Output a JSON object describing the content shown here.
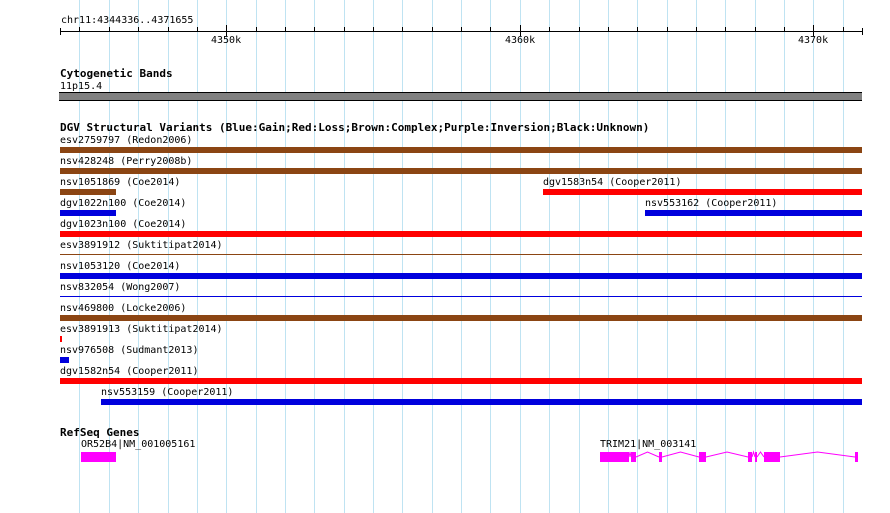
{
  "locus": "chr11:4344336..4371655",
  "ruler": {
    "ticks": [
      {
        "pos": 4350000,
        "label": "4350k"
      },
      {
        "pos": 4360000,
        "label": "4360k"
      },
      {
        "pos": 4370000,
        "label": "4370k"
      }
    ]
  },
  "tracks": {
    "cytobands": {
      "title": "Cytogenetic Bands",
      "band": "11p15.4",
      "color": "#808080"
    },
    "dgv": {
      "title": "DGV Structural Variants (Blue:Gain;Red:Loss;Brown:Complex;Purple:Inversion;Black:Unknown)",
      "colors": {
        "gain": "#0000dd",
        "loss": "#ff0000",
        "complex": "#8b4513"
      },
      "features": [
        {
          "name": "esv2759797 (Redon2006)",
          "type": "complex",
          "start": 4344336,
          "end": 4371655,
          "thick": true
        },
        {
          "name": "nsv428248 (Perry2008b)",
          "type": "complex",
          "start": 4344336,
          "end": 4371655,
          "thick": true
        },
        {
          "name": "nsv1051869 (Coe2014)",
          "type": "complex",
          "start": 4344336,
          "end": 4346250,
          "thick": true
        },
        {
          "name": "dgv1583n54 (Cooper2011)",
          "type": "loss",
          "start": 4360780,
          "end": 4371655,
          "thick": true
        },
        {
          "name": "dgv1022n100 (Coe2014)",
          "type": "gain",
          "start": 4344336,
          "end": 4346250,
          "thick": true
        },
        {
          "name": "nsv553162 (Cooper2011)",
          "type": "gain",
          "start": 4364250,
          "end": 4371655,
          "thick": true
        },
        {
          "name": "dgv1023n100 (Coe2014)",
          "type": "loss",
          "start": 4344336,
          "end": 4371655,
          "thick": true
        },
        {
          "name": "esv3891912 (Suktitipat2014)",
          "type": "complex",
          "start": 4344336,
          "end": 4371655,
          "thick": false
        },
        {
          "name": "nsv1053120 (Coe2014)",
          "type": "gain",
          "start": 4344336,
          "end": 4371655,
          "thick": true
        },
        {
          "name": "nsv832054 (Wong2007)",
          "type": "gain",
          "start": 4344336,
          "end": 4371655,
          "thick": false
        },
        {
          "name": "nsv469800 (Locke2006)",
          "type": "complex",
          "start": 4344336,
          "end": 4371655,
          "thick": true
        },
        {
          "name": "esv3891913 (Suktitipat2014)",
          "type": "loss",
          "start": 4344336,
          "end": 4344420,
          "thick": true
        },
        {
          "name": "nsv976508 (Sudmant2013)",
          "type": "gain",
          "start": 4344336,
          "end": 4344640,
          "thick": true
        },
        {
          "name": "dgv1582n54 (Cooper2011)",
          "type": "loss",
          "start": 4344336,
          "end": 4371655,
          "thick": true
        },
        {
          "name": "nsv553159 (Cooper2011)",
          "type": "gain",
          "start": 4345730,
          "end": 4371655,
          "thick": true
        }
      ]
    },
    "refseq": {
      "title": "RefSeq Genes",
      "color": "#ff00ff",
      "genes": [
        {
          "name": "OR52B4|NM_001005161",
          "start": 4345050,
          "end": 4346250,
          "exons": [
            [
              4345050,
              4346250
            ]
          ]
        },
        {
          "name": "TRIM21|NM_003141",
          "start": 4362740,
          "end": 4371520,
          "exons": [
            [
              4362740,
              4363720
            ],
            [
              4363800,
              4363950
            ],
            [
              4364750,
              4364850
            ],
            [
              4366100,
              4366330
            ],
            [
              4367780,
              4367900
            ],
            [
              4368010,
              4368080
            ],
            [
              4368320,
              4368860
            ],
            [
              4371430,
              4371520
            ]
          ]
        }
      ]
    }
  }
}
